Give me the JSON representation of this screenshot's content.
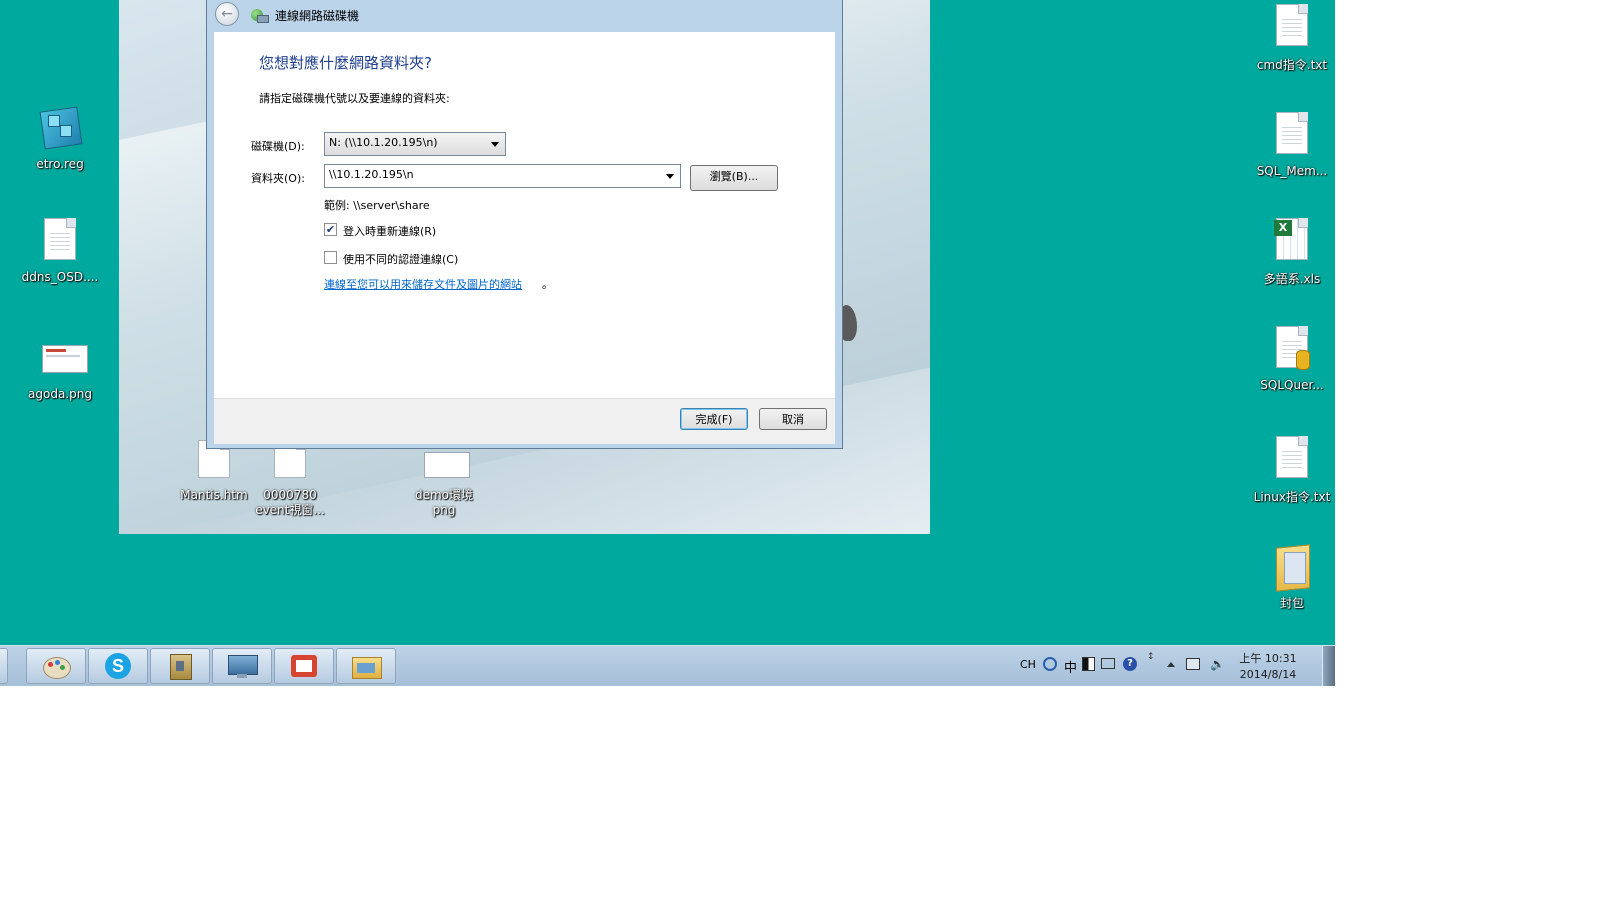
{
  "desktop": {
    "left_icons": [
      {
        "label": "etro.reg",
        "icon": "registry-file-icon"
      },
      {
        "label": "ddns_OSD....",
        "icon": "text-file-icon"
      },
      {
        "label": "agoda.png",
        "icon": "image-file-icon"
      }
    ],
    "wallpaper_icons": [
      {
        "label": "Mantis.htm",
        "icon": "html-file-icon"
      },
      {
        "label": "0000780\nevent視窗...",
        "icon": "file-icon"
      },
      {
        "label": "demo環境\npng",
        "icon": "image-file-icon"
      }
    ],
    "right_icons": [
      {
        "label": "cmd指令.txt",
        "icon": "text-file-icon"
      },
      {
        "label": "SQL_Mem...",
        "icon": "text-file-icon"
      },
      {
        "label": "多語系.xls",
        "icon": "excel-file-icon"
      },
      {
        "label": "SQLQuer...",
        "icon": "sql-file-icon"
      },
      {
        "label": "Linux指令.txt",
        "icon": "text-file-icon"
      },
      {
        "label": "封包",
        "icon": "folder-icon"
      }
    ]
  },
  "dialog": {
    "title": "連線網路磁碟機",
    "heading": "您想對應什麼網路資料夾?",
    "subtext": "請指定磁碟機代號以及要連線的資料夾:",
    "drive_label": "磁碟機(D):",
    "drive_value": "N: (\\\\10.1.20.195\\n)",
    "folder_label": "資料夾(O):",
    "folder_value": "\\\\10.1.20.195\\n",
    "browse_label": "瀏覽(B)...",
    "example": "範例: \\\\server\\share",
    "reconnect_label": "登入時重新連線(R)",
    "reconnect_checked": true,
    "different_cred_label": "使用不同的認證連線(C)",
    "different_cred_checked": false,
    "link_text": "連線至您可以用來儲存文件及圖片的網站",
    "link_suffix": "。",
    "finish_label": "完成(F)",
    "cancel_label": "取消"
  },
  "taskbar": {
    "apps": [
      "paint-icon",
      "skype-icon",
      "archive-icon",
      "remote-desktop-icon",
      "office-app-icon",
      "file-explorer-icon"
    ],
    "tray": {
      "lang": "CH",
      "ime": "中",
      "time": "上午 10:31",
      "date": "2014/8/14"
    }
  }
}
